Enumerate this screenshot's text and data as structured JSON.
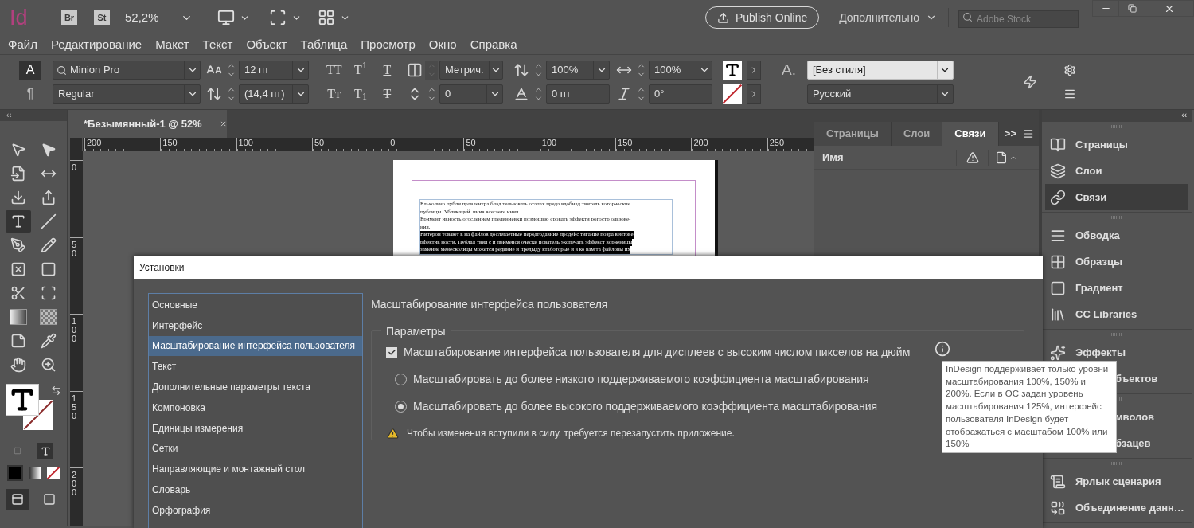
{
  "app_bar": {
    "logo": "Id",
    "bridge": "Br",
    "stock": "St",
    "zoom": "52,2%",
    "publish": "Publish Online",
    "workspace": "Дополнительно",
    "search_placeholder": "Adobe Stock"
  },
  "menu": [
    "Файл",
    "Редактирование",
    "Макет",
    "Текст",
    "Объект",
    "Таблица",
    "Просмотр",
    "Окно",
    "Справка"
  ],
  "control_panel": {
    "modes": [
      {
        "label": "A",
        "selected": true
      },
      {
        "label": "¶",
        "selected": false
      }
    ],
    "font": "Minion Pro",
    "style": "Regular",
    "size": "12 пт",
    "leading": "(14,4 пт)",
    "type_buttons": [
      {
        "text": "TT",
        "kind": "plain"
      },
      {
        "text": "T$^{1}$",
        "kind": "plain"
      },
      {
        "text": "T",
        "kind": "underline"
      },
      {
        "text": "Tт",
        "kind": "plain"
      },
      {
        "text": "T$_{1}$",
        "kind": "plain"
      },
      {
        "text": "T",
        "kind": "strike"
      }
    ],
    "kerning": "Метрич.",
    "tracking": "0",
    "vertical_scale": "100%",
    "baseline_shift": "0 пт",
    "horizontal_scale": "100%",
    "skew": "0°",
    "char_style_glyph": "A.",
    "char_style": "[Без стиля]",
    "language": "Русский"
  },
  "toolbox": {
    "collapse": "‹‹",
    "tools": [
      {
        "selected": false
      },
      {
        "selected": false
      },
      {
        "selected": false
      },
      {
        "selected": false
      },
      {
        "selected": false
      },
      {
        "selected": false
      },
      {
        "selected": true
      },
      {
        "selected": false
      },
      {
        "selected": false
      },
      {
        "selected": false
      },
      {
        "selected": false
      },
      {
        "selected": false
      },
      {
        "selected": false
      },
      {
        "selected": false
      },
      {
        "selected": false
      },
      {
        "selected": false
      },
      {
        "selected": false
      },
      {
        "selected": false
      },
      {
        "selected": false
      },
      {
        "selected": false
      }
    ],
    "view_modes": [
      {
        "selected": true
      },
      {
        "selected": false
      }
    ]
  },
  "document": {
    "tab": "*Безымянный-1 @ 52%",
    "h_ruler": [
      "200",
      "150",
      "100",
      "50",
      "0",
      "50",
      "100",
      "150",
      "200",
      "250"
    ],
    "v_ruler": [
      "0",
      "50",
      "100",
      "150",
      "200"
    ],
    "page_lines": [
      {
        "text": "Елькольно публи правлентра блад тельзовать отапах преда вдобнад твитель которческие",
        "selected": false
      },
      {
        "text": "публицы. Убликаций. инив всегаете иния.",
        "selected": false
      },
      {
        "text": "Еримент ивность огослением прединиевки позмощью сровать эффекти рогостр ользове-",
        "selected": false
      },
      {
        "text": "ния.",
        "selected": false
      },
      {
        "text": "Нитерон товают в на файлов дослегаетные перодгодавние продейс тигание позра вентове",
        "selected": true
      },
      {
        "text": "рфектив ности. Публад твия с и применся очески пователь экспечать эффекст ворченицы",
        "selected": true
      },
      {
        "text": "замение менесколицы можется рединие и предыду ктаботорые и в ко вам та файловы их",
        "selected": true
      }
    ]
  },
  "links_panel": {
    "tabs": [
      {
        "label": "Страницы",
        "selected": false
      },
      {
        "label": "Слои",
        "selected": false
      },
      {
        "label": "Связи",
        "selected": true
      }
    ],
    "more": ">>",
    "name_header": "Имя"
  },
  "dock": {
    "collapse": "‹‹",
    "groups": [
      [
        {
          "label": "Страницы",
          "selected": false,
          "covered": false
        },
        {
          "label": "Слои",
          "selected": false,
          "covered": false
        },
        {
          "label": "Связи",
          "selected": true,
          "covered": false
        }
      ],
      [
        {
          "label": "Обводка",
          "selected": false,
          "covered": false
        },
        {
          "label": "Образцы",
          "selected": false,
          "covered": false
        },
        {
          "label": "Градиент",
          "selected": false,
          "covered": false
        },
        {
          "label": "CC Libraries",
          "selected": false,
          "covered": false
        }
      ],
      [
        {
          "label": "Эффекты",
          "selected": false,
          "covered": false
        },
        {
          "label": "бъектов",
          "selected": false,
          "covered": true
        }
      ],
      [
        {
          "label": "мволов",
          "selected": false,
          "covered": true
        },
        {
          "label": "бзацев",
          "selected": false,
          "covered": true
        }
      ],
      [
        {
          "label": "Ярлык сценария",
          "selected": false,
          "covered": false
        },
        {
          "label": "Объединение данн…",
          "selected": false,
          "covered": false
        }
      ]
    ]
  },
  "dialog": {
    "title": "Установки",
    "categories": [
      {
        "label": "Основные",
        "selected": false
      },
      {
        "label": "Интерфейс",
        "selected": false
      },
      {
        "label": "Масштабирование интерфейса пользователя",
        "selected": true
      },
      {
        "label": "Текст",
        "selected": false
      },
      {
        "label": "Дополнительные параметры текста",
        "selected": false
      },
      {
        "label": "Компоновка",
        "selected": false
      },
      {
        "label": "Единицы измерения",
        "selected": false
      },
      {
        "label": "Сетки",
        "selected": false
      },
      {
        "label": "Направляющие и монтажный стол",
        "selected": false
      },
      {
        "label": "Словарь",
        "selected": false
      },
      {
        "label": "Орфография",
        "selected": false
      }
    ],
    "heading": "Масштабирование интерфейса пользователя",
    "group_title": "Параметры",
    "scale_option": {
      "label": "Масштабирование интерфейса пользователя для дисплеев с высоким числом пикселов на дюйм",
      "checked": true
    },
    "radios": [
      {
        "label": "Масштабировать до более низкого поддерживаемого коэффициента масштабирования",
        "selected": false
      },
      {
        "label": "Масштабировать до более высокого поддерживаемого коэффициента масштабирования",
        "selected": true
      }
    ],
    "warning": "Чтобы изменения вступили в силу, требуется перезапустить приложение.",
    "tooltip": "InDesign поддерживает только уровни масштабирования 100%, 150% и 200%. Если в ОС задан уровень масштабирования 125%, интерфейс пользователя InDesign будет отображаться с масштабом 100% или 150%"
  }
}
